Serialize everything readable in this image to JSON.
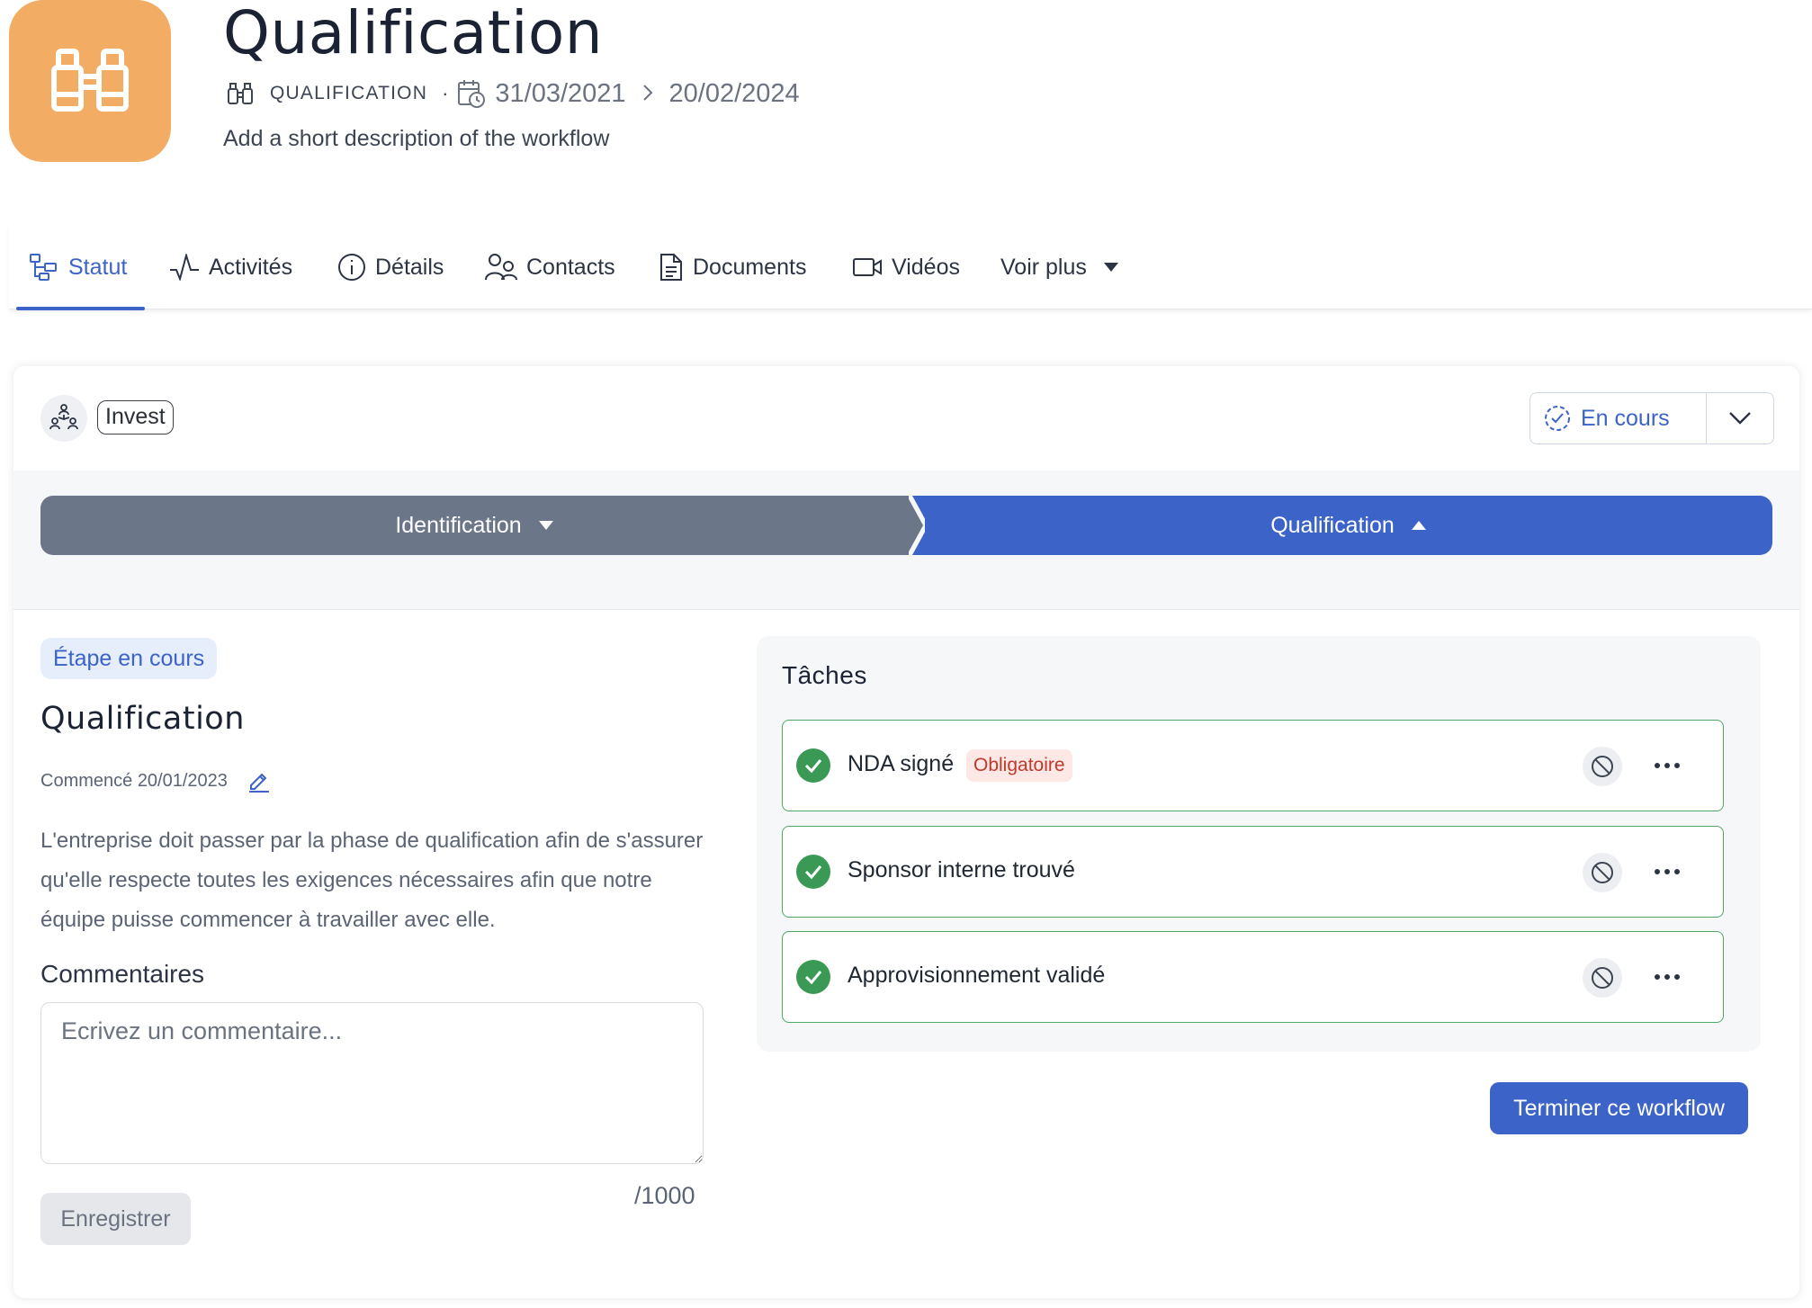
{
  "header": {
    "icon": "binoculars-icon",
    "icon_color": "#f3ac63",
    "title": "Qualification",
    "type_label": "QUALIFICATION",
    "separator": "·",
    "date_start": "31/03/2021",
    "date_end": "20/02/2024",
    "description": "Add a short description of the workflow"
  },
  "tabs": [
    {
      "label": "Statut",
      "icon": "workflow-icon",
      "active": true
    },
    {
      "label": "Activités",
      "icon": "activity-icon"
    },
    {
      "label": "Détails",
      "icon": "info-icon"
    },
    {
      "label": "Contacts",
      "icon": "contacts-icon"
    },
    {
      "label": "Documents",
      "icon": "document-icon"
    },
    {
      "label": "Vidéos",
      "icon": "video-icon"
    },
    {
      "label": "Voir plus",
      "icon": "caret-down-icon"
    }
  ],
  "card": {
    "org_tag": "Invest",
    "status": "En cours"
  },
  "stepper": {
    "steps": [
      {
        "label": "Identification",
        "state": "done",
        "color": "#6b7689"
      },
      {
        "label": "Qualification",
        "state": "current",
        "color": "#3b63c8"
      }
    ]
  },
  "stage": {
    "badge": "Étape en cours",
    "title": "Qualification",
    "started": "Commencé 20/01/2023",
    "description": "L'entreprise doit passer par la phase de qualification afin de s'assurer qu'elle respecte toutes les exigences nécessaires afin que notre équipe puisse commencer à travailler avec elle."
  },
  "comments": {
    "title": "Commentaires",
    "placeholder": "Ecrivez un commentaire...",
    "value": "",
    "counter": "/1000",
    "save_label": "Enregistrer"
  },
  "tasks": {
    "title": "Tâches",
    "items": [
      {
        "name": "NDA signé",
        "tag": "Obligatoire",
        "done": true
      },
      {
        "name": "Sponsor interne trouvé",
        "done": true
      },
      {
        "name": "Approvisionnement validé",
        "done": true
      }
    ],
    "finish_label": "Terminer ce workflow"
  },
  "colors": {
    "accent": "#3b63c8",
    "success": "#3a9a55",
    "danger": "#c0392b"
  }
}
